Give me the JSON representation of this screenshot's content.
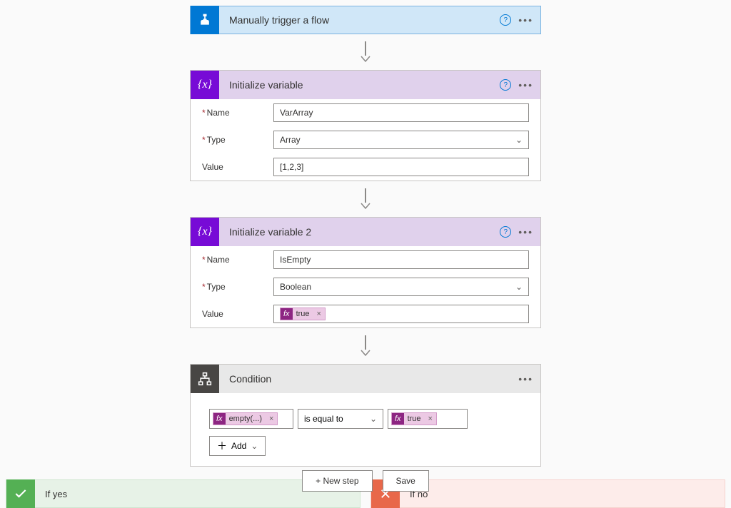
{
  "trigger": {
    "title": "Manually trigger a flow"
  },
  "var1": {
    "title": "Initialize variable",
    "labels": {
      "name": "Name",
      "type": "Type",
      "value": "Value"
    },
    "name": "VarArray",
    "type": "Array",
    "value": "[1,2,3]"
  },
  "var2": {
    "title": "Initialize variable 2",
    "labels": {
      "name": "Name",
      "type": "Type",
      "value": "Value"
    },
    "name": "IsEmpty",
    "type": "Boolean",
    "token": "true"
  },
  "condition": {
    "title": "Condition",
    "left_token": "empty(...)",
    "op": "is equal to",
    "right_token": "true",
    "add": "Add"
  },
  "branches": {
    "yes": "If yes",
    "no": "If no"
  },
  "footer": {
    "newstep": "+ New step",
    "save": "Save"
  },
  "glyphs": {
    "fx": "fx",
    "x": "×",
    "chev": "⌄",
    "plus": "＋",
    "asterisk": "*"
  }
}
